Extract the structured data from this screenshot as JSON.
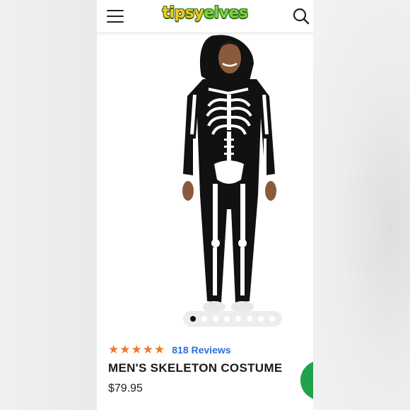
{
  "header": {
    "logo_text_1": "tipsy",
    "logo_text_2": "elves",
    "menu_icon": "hamburger-menu-icon",
    "search_icon": "search-icon"
  },
  "product": {
    "image_description": "skeleton onesie costume worn by model",
    "carousel": {
      "total": 8,
      "active_index": 0
    },
    "rating": {
      "stars": 5,
      "reviews_label": "818 Reviews"
    },
    "title": "MEN'S SKELETON COSTUME",
    "price": "$79.95"
  },
  "colors": {
    "star": "#f0782a",
    "reviews_link": "#2e6fd8",
    "chat_button": "#1fa24a",
    "logo_yellow": "#f7c623",
    "logo_green": "#7fd33a"
  }
}
